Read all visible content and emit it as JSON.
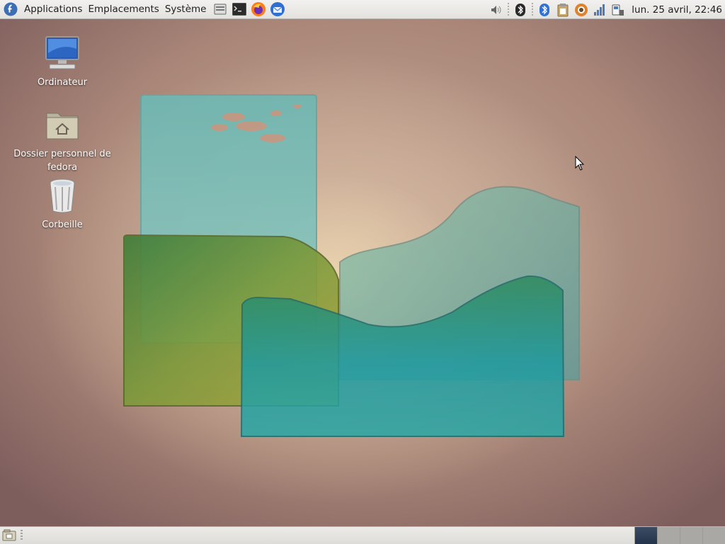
{
  "top_panel": {
    "logo_icon": "fedora-icon",
    "menus": [
      "Applications",
      "Emplacements",
      "Système"
    ],
    "launchers": [
      "file-manager-icon",
      "terminal-icon",
      "firefox-icon",
      "thunderbird-icon"
    ],
    "tray_icons": [
      "volume-icon",
      "bluetooth-icon",
      "bluetooth-applet-icon",
      "clipboard-icon",
      "software-update-icon",
      "network-signal-icon",
      "power-icon"
    ],
    "clock": "lun. 25 avril, 22:46"
  },
  "desktop": {
    "icons": [
      {
        "label": "Ordinateur",
        "icon": "computer-icon"
      },
      {
        "label": "Dossier personnel de fedora",
        "icon": "home-folder-icon"
      },
      {
        "label": "Corbeille",
        "icon": "trash-icon"
      }
    ]
  },
  "bottom_panel": {
    "show_desktop_icon": "show-desktop-icon",
    "workspaces": 4,
    "active_workspace": 1
  },
  "colors": {
    "panel_bg": "#e8e7e4",
    "active_workspace": "#2e3f55",
    "fedora_blue": "#3c6eb4"
  }
}
